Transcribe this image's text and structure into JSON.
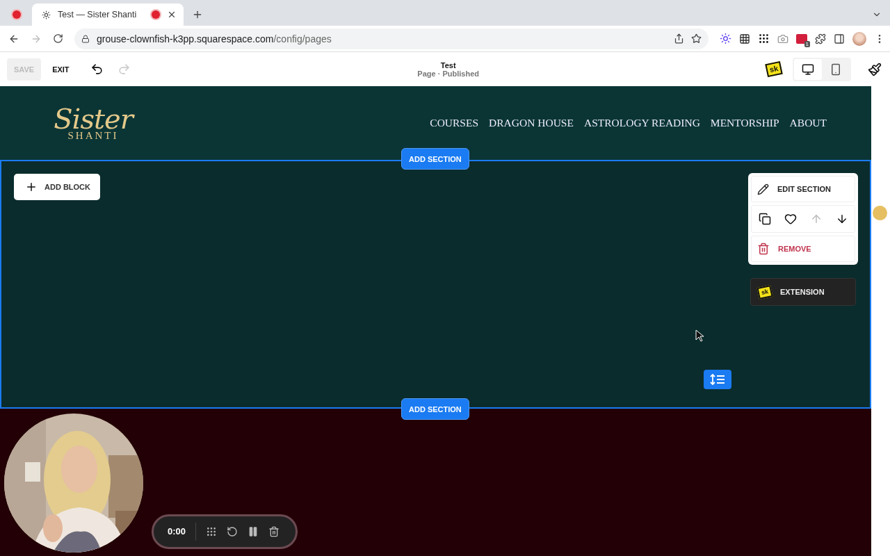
{
  "browser": {
    "tabs": [
      {
        "title": "Test — Sister Shanti",
        "selected": true,
        "recording": true
      }
    ],
    "url": {
      "host": "grouse-clownfish-k3pp.squarespace.com",
      "path": "/config/pages"
    },
    "extension_badge": "1"
  },
  "editor": {
    "save": {
      "label": "SAVE",
      "disabled": true
    },
    "exit": "EXIT",
    "redo_disabled": true,
    "page_title": "Test",
    "page_status": "Page · Published",
    "sk_badge": "sk",
    "view_modes": [
      {
        "kind": "desktop",
        "selected": true
      },
      {
        "kind": "mobile",
        "selected": false
      }
    ]
  },
  "site_header": {
    "logo": {
      "script": "Sister",
      "caps": "SHANTI"
    },
    "nav": [
      "COURSES",
      "DRAGON HOUSE",
      "ASTROLOGY READING",
      "MENTORSHIP",
      "ABOUT"
    ]
  },
  "add_section_buttons": [
    "ADD SECTION",
    "ADD SECTION"
  ],
  "add_block": "ADD BLOCK",
  "section_menu": {
    "edit": "EDIT SECTION",
    "actions": [
      {
        "kind": "duplicate",
        "disabled": false
      },
      {
        "kind": "favorite",
        "disabled": false
      },
      {
        "kind": "up",
        "disabled": true
      },
      {
        "kind": "down",
        "disabled": false
      }
    ],
    "remove": "REMOVE",
    "extension": {
      "badge": "sk",
      "label": "EXTENSION"
    }
  },
  "recorder": {
    "time": "0:00"
  }
}
